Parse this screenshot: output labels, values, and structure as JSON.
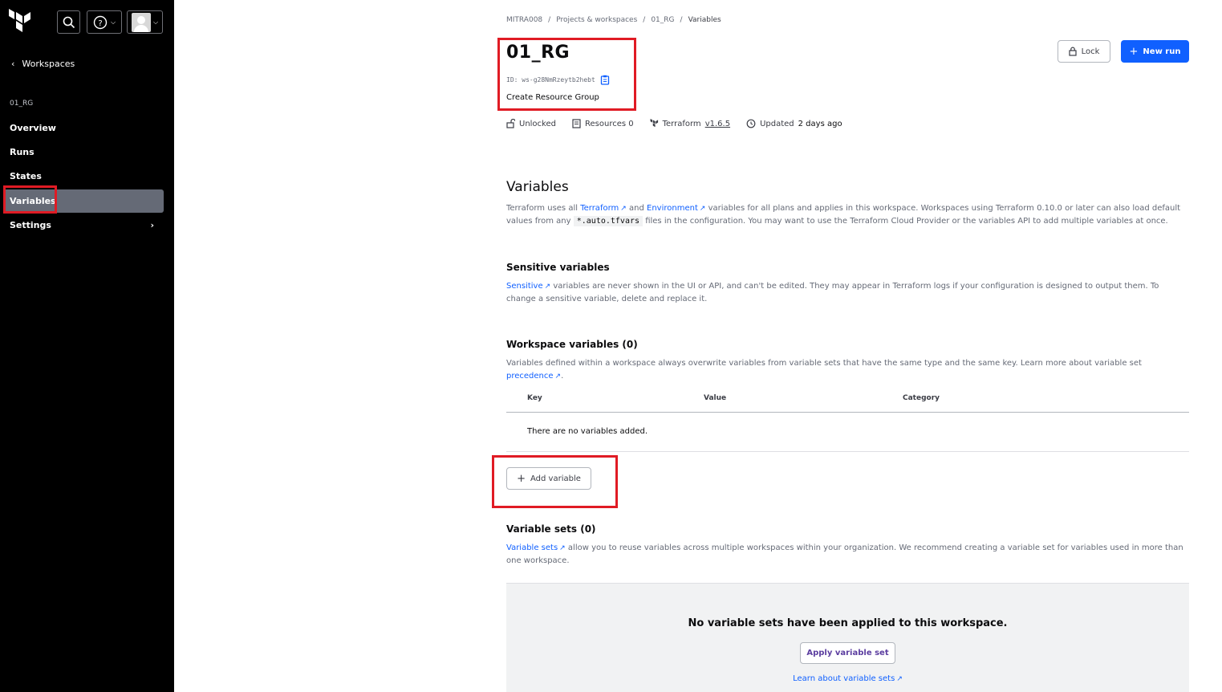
{
  "sidebar": {
    "back_label": "Workspaces",
    "workspace_name": "01_RG",
    "items": [
      {
        "label": "Overview"
      },
      {
        "label": "Runs"
      },
      {
        "label": "States"
      },
      {
        "label": "Variables"
      },
      {
        "label": "Settings"
      }
    ]
  },
  "breadcrumb": [
    "MITRA008",
    "Projects & workspaces",
    "01_RG",
    "Variables"
  ],
  "header": {
    "title": "01_RG",
    "id_label": "ID: ws-g28NmRzeytb2hebt",
    "description": "Create Resource Group",
    "lock_label": "Lock",
    "new_run_label": "New run"
  },
  "meta": {
    "lock_state": "Unlocked",
    "resources": "Resources 0",
    "terraform_prefix": "Terraform",
    "terraform_version": "v1.6.5",
    "updated_prefix": "Updated",
    "updated_value": "2 days ago"
  },
  "variables": {
    "heading": "Variables",
    "intro": {
      "p1": "Terraform uses all",
      "link_terraform": "Terraform",
      "p2": "and",
      "link_environment": "Environment",
      "p3": "variables for all plans and applies in this workspace. Workspaces using Terraform 0.10.0 or later can also load default values from any",
      "code": "*.auto.tfvars",
      "p4": "files in the configuration. You may want to use the Terraform Cloud Provider or the variables API to add multiple variables at once."
    }
  },
  "sensitive": {
    "heading": "Sensitive variables",
    "link": "Sensitive",
    "text": "variables are never shown in the UI or API, and can't be edited. They may appear in Terraform logs if your configuration is designed to output them. To change a sensitive variable, delete and replace it."
  },
  "workspace_vars": {
    "heading": "Workspace variables (0)",
    "text": "Variables defined within a workspace always overwrite variables from variable sets that have the same type and the same key. Learn more about variable set",
    "link": "precedence",
    "columns": [
      "Key",
      "Value",
      "Category"
    ],
    "empty": "There are no variables added.",
    "add_label": "Add variable"
  },
  "variable_sets": {
    "heading": "Variable sets (0)",
    "link": "Variable sets",
    "text": "allow you to reuse variables across multiple workspaces within your organization. We recommend creating a variable set for variables used in more than one workspace.",
    "empty_title": "No variable sets have been applied to this workspace.",
    "apply_label": "Apply variable set",
    "learn_label": "Learn about variable sets"
  },
  "colors": {
    "sidebar_bg": "#000000",
    "active_item": "#656a76",
    "accent": "#1060ff",
    "highlight": "#e01b24"
  }
}
